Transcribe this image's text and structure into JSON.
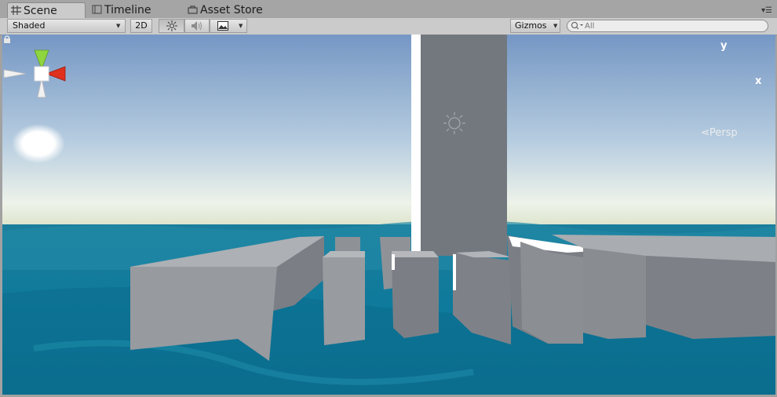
{
  "tabs": [
    {
      "label": "Scene",
      "icon": "grid-icon",
      "active": true
    },
    {
      "label": "Timeline",
      "icon": "timeline-icon",
      "active": false
    },
    {
      "label": "Asset Store",
      "icon": "store-icon",
      "active": false
    }
  ],
  "toolbar": {
    "draw_mode": "Shaded",
    "mode_2d_label": "2D",
    "lighting_icon": "sun-icon",
    "audio_icon": "speaker-icon",
    "effects_icon": "image-icon",
    "gizmos_label": "Gizmos",
    "search_placeholder": "All"
  },
  "scene_gizmo": {
    "y_label": "y",
    "x_label": "x",
    "projection_label": "Persp",
    "colors": {
      "y": "#8fd53f",
      "x": "#e0301e",
      "neutral": "#ffffff"
    }
  },
  "scene": {
    "sky_top": "#7898c2",
    "sky_horizon": "#f3f4e4",
    "water": "#0f7e9e",
    "block_color": "#7a7f86"
  }
}
